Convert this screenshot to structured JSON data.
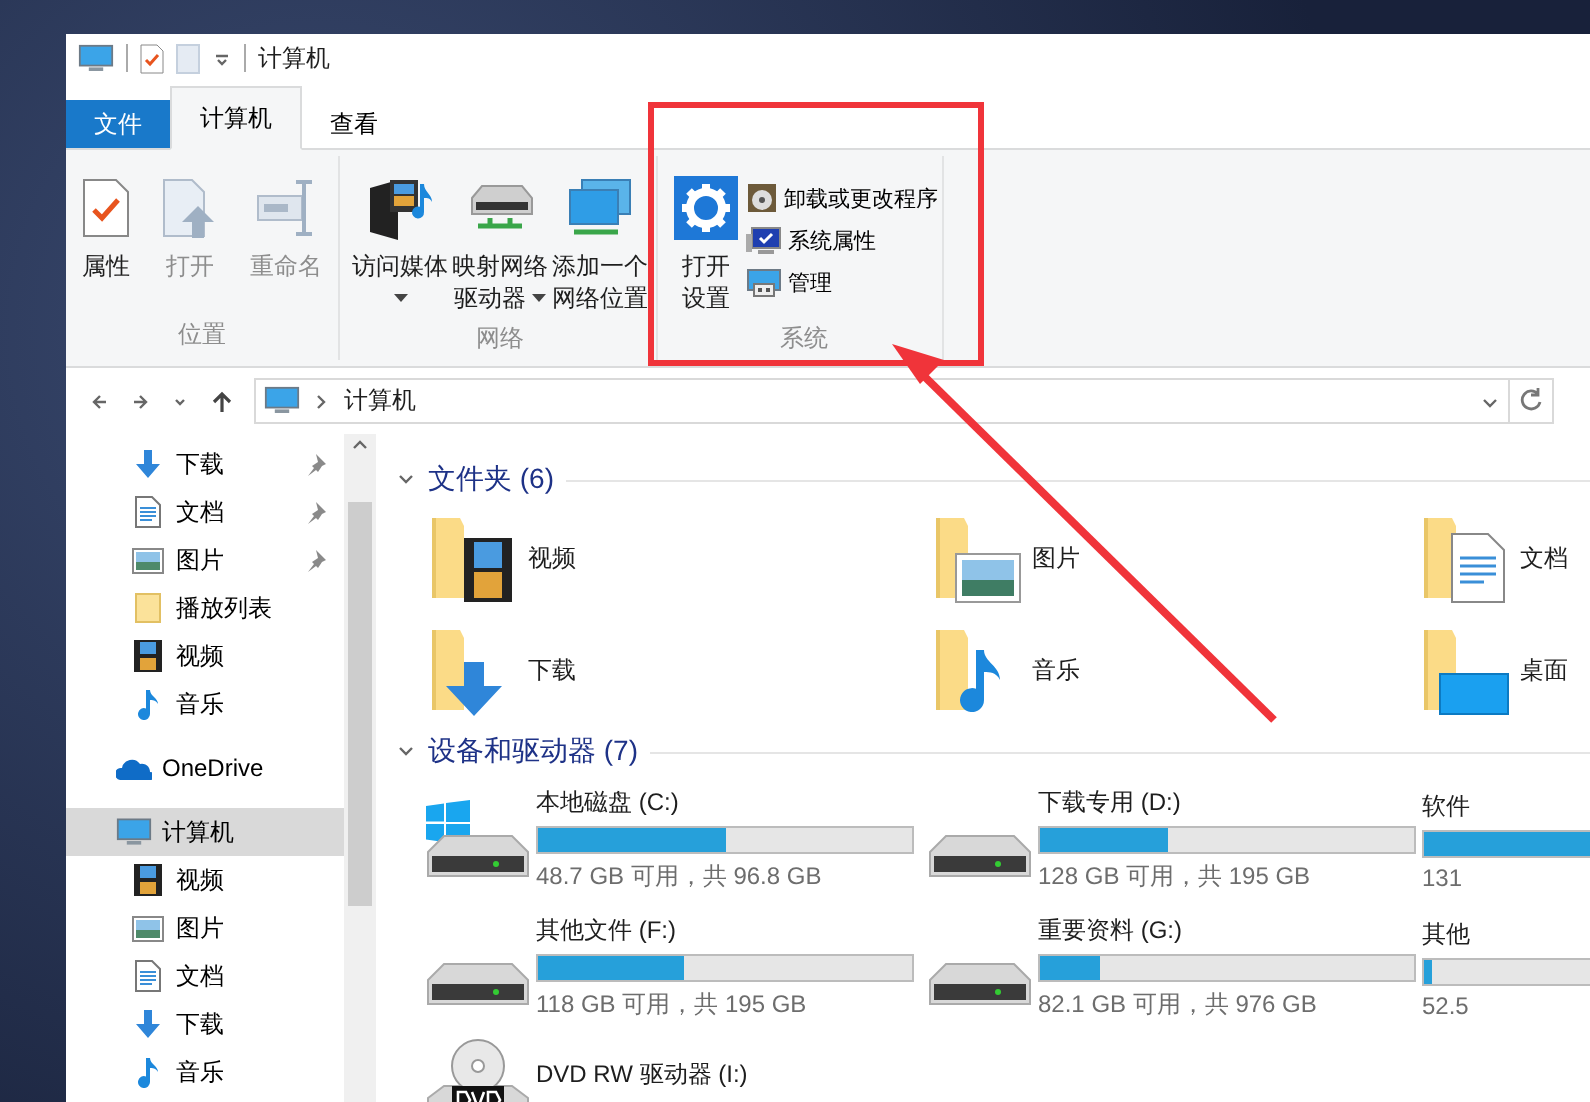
{
  "window": {
    "title": "计算机"
  },
  "ribbon_tabs": [
    {
      "label": "文件",
      "kind": "file",
      "selected": false
    },
    {
      "label": "计算机",
      "kind": "tab",
      "selected": true
    },
    {
      "label": "查看",
      "kind": "tab",
      "selected": false
    }
  ],
  "ribbon_groups": [
    {
      "label": "位置",
      "buttons": [
        {
          "label": "属性",
          "kind": "properties",
          "disabled": false,
          "dropdown": false
        },
        {
          "label": "打开",
          "kind": "open",
          "disabled": true,
          "dropdown": false
        },
        {
          "label": "重命名",
          "kind": "rename",
          "disabled": true,
          "dropdown": false
        }
      ]
    },
    {
      "label": "网络",
      "buttons": [
        {
          "label": "访问媒体",
          "kind": "media",
          "disabled": false,
          "dropdown": true
        },
        {
          "label": "映射网络驱动器",
          "kind": "map-drive",
          "disabled": false,
          "dropdown": true
        },
        {
          "label": "添加一个网络位置",
          "kind": "add-location",
          "disabled": false,
          "dropdown": false
        }
      ]
    },
    {
      "label": "系统",
      "buttons": [
        {
          "label": "打开设置",
          "kind": "settings",
          "disabled": false,
          "dropdown": false
        }
      ],
      "small_buttons": [
        {
          "label": "卸载或更改程序",
          "kind": "uninstall"
        },
        {
          "label": "系统属性",
          "kind": "system-properties"
        },
        {
          "label": "管理",
          "kind": "manage"
        }
      ]
    }
  ],
  "address_bar": {
    "path": [
      "计算机"
    ]
  },
  "navigation": {
    "quick_access": [
      {
        "label": "下载",
        "kind": "download",
        "pinned": true
      },
      {
        "label": "文档",
        "kind": "document",
        "pinned": true
      },
      {
        "label": "图片",
        "kind": "picture",
        "pinned": true
      },
      {
        "label": "播放列表",
        "kind": "folder",
        "pinned": false
      },
      {
        "label": "视频",
        "kind": "video",
        "pinned": false
      },
      {
        "label": "音乐",
        "kind": "music",
        "pinned": false
      }
    ],
    "items": [
      {
        "label": "OneDrive",
        "kind": "onedrive",
        "selected": false
      },
      {
        "label": "计算机",
        "kind": "computer",
        "selected": true,
        "children": [
          {
            "label": "视频",
            "kind": "video",
            "selected": false
          },
          {
            "label": "图片",
            "kind": "picture",
            "selected": false
          },
          {
            "label": "文档",
            "kind": "document",
            "selected": false
          },
          {
            "label": "下载",
            "kind": "download",
            "selected": false
          },
          {
            "label": "音乐",
            "kind": "music",
            "selected": false
          }
        ]
      }
    ]
  },
  "folders": {
    "title": "文件夹 (6)",
    "expanded": true,
    "items": [
      {
        "label": "视频",
        "kind": "video"
      },
      {
        "label": "图片",
        "kind": "picture"
      },
      {
        "label": "文档",
        "kind": "document"
      },
      {
        "label": "下载",
        "kind": "download"
      },
      {
        "label": "音乐",
        "kind": "music"
      },
      {
        "label": "桌面",
        "kind": "desktop"
      }
    ]
  },
  "drives": {
    "title": "设备和驱动器 (7)",
    "expanded": true,
    "items": [
      {
        "name": "本地磁盘 (C:)",
        "kind": "system",
        "level": 0.5,
        "free": "48.7 GB 可用，共 96.8 GB"
      },
      {
        "name": "下载专用 (D:)",
        "kind": "disk",
        "level": 0.34,
        "free": "128 GB 可用，共 195 GB"
      },
      {
        "name": "软件",
        "kind": "disk",
        "level": 0.6,
        "free": "131"
      },
      {
        "name": "其他文件 (F:)",
        "kind": "disk",
        "level": 0.39,
        "free": "118 GB 可用，共 195 GB"
      },
      {
        "name": "重要资料 (G:)",
        "kind": "disk",
        "level": 0.16,
        "free": "82.1 GB 可用，共 976 GB"
      },
      {
        "name": "其他",
        "kind": "disk",
        "level": 0.02,
        "free": "52.5"
      },
      {
        "name": "DVD RW 驱动器 (I:)",
        "kind": "dvd"
      }
    ]
  }
}
